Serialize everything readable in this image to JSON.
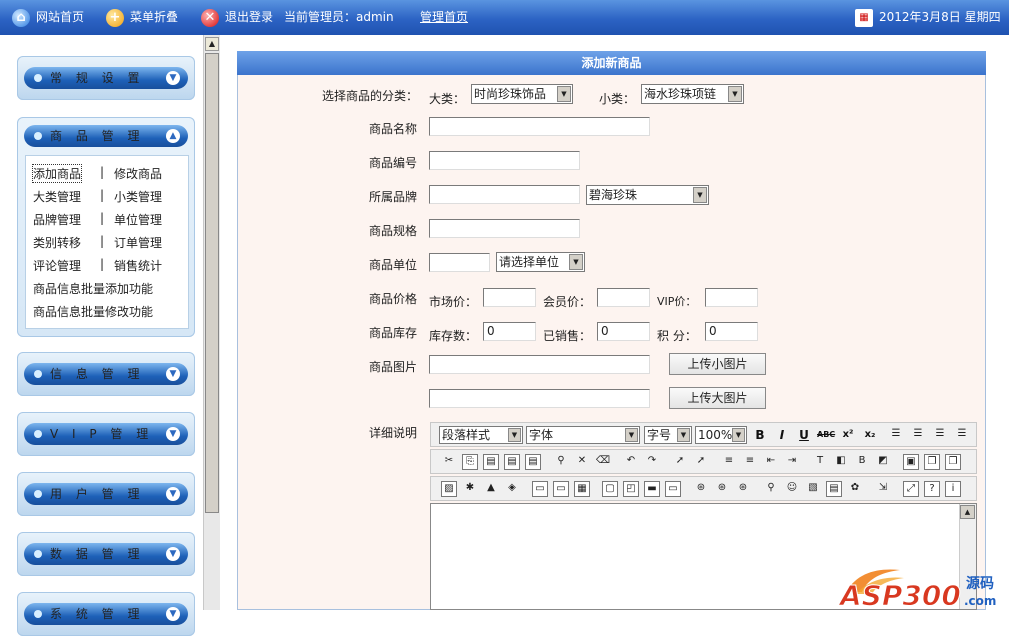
{
  "topbar": {
    "home": "网站首页",
    "fold_menu": "菜单折叠",
    "logout": "退出登录",
    "admin_prefix": "当前管理员：",
    "admin_name": "admin",
    "admin_home": "管理首页",
    "date": "2012年3月8日",
    "weekday": "星期四"
  },
  "sidebar": {
    "menus": [
      "常 规 设 置",
      "商 品 管 理",
      "信 息 管 理",
      "V I P 管 理",
      "用 户 管 理",
      "数 据 管 理",
      "系 统 管 理"
    ],
    "sublinks": {
      "add_product": "添加商品",
      "edit_product": "修改商品",
      "category_mgmt": "大类管理",
      "subcategory_mgmt": "小类管理",
      "brand_mgmt": "品牌管理",
      "unit_mgmt": "单位管理",
      "category_transfer": "类别转移",
      "order_mgmt": "订单管理",
      "review_mgmt": "评论管理",
      "sales_stats": "销售统计",
      "batch_add": "商品信息批量添加功能",
      "batch_edit": "商品信息批量修改功能"
    },
    "separator": "|"
  },
  "form": {
    "heading": "添加新商品",
    "category_label": "选择商品的分类：",
    "major_label": "大类：",
    "major_value": "时尚珍珠饰品",
    "minor_label": "小类：",
    "minor_value": "海水珍珠项链",
    "name_label": "商品名称",
    "code_label": "商品编号",
    "brand_label": "所属品牌",
    "brand_value": "碧海珍珠",
    "spec_label": "商品规格",
    "unit_label": "商品单位",
    "unit_placeholder": "请选择单位",
    "price_label": "商品价格",
    "market_price_label": "市场价：",
    "member_price_label": "会员价：",
    "vip_price_label": "VIP价：",
    "stock_label": "商品库存",
    "stock_qty_label": "库存数：",
    "stock_qty_value": "0",
    "sold_label": "已销售：",
    "sold_value": "0",
    "points_label": "积  分：",
    "points_value": "0",
    "image_label": "商品图片",
    "upload_small": "上传小图片",
    "upload_large": "上传大图片",
    "detail_label": "详细说明"
  },
  "editor": {
    "paragraph_style": "段落样式",
    "font": "字体",
    "font_size": "字号",
    "zoom": "100%",
    "bold": "B",
    "italic": "I",
    "underline": "U",
    "strike": "ABC",
    "superscript": "x²",
    "subscript": "x₂"
  },
  "watermark": {
    "brand": "ASP300",
    "suffix": "源码",
    "domain": ".com"
  }
}
